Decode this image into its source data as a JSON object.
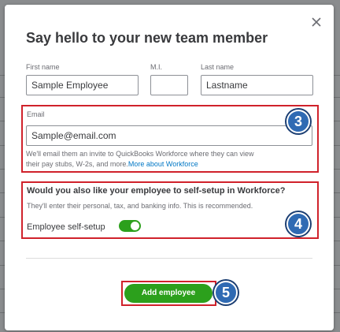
{
  "modal": {
    "title": "Say hello to your new team member"
  },
  "name_fields": {
    "first_name_label": "First name",
    "first_name_value": "Sample Employee",
    "mi_label": "M.I.",
    "mi_value": "",
    "last_name_label": "Last name",
    "last_name_value": "Lastname"
  },
  "email_section": {
    "label": "Email",
    "value": "Sample@email.com",
    "help_line1": "We'll email them an invite to QuickBooks Workforce where they can view",
    "help_line2": "their pay stubs, W-2s, and more.",
    "help_link": "More about Workforce",
    "step_badge": "3"
  },
  "self_setup_section": {
    "question": "Would you also like your employee to self-setup in Workforce?",
    "description": "They'll enter their personal, tax, and banking info. This is recommended.",
    "toggle_label": "Employee self-setup",
    "toggle_state": "on",
    "step_badge": "4"
  },
  "footer": {
    "add_button_label": "Add employee",
    "step_badge": "5"
  },
  "colors": {
    "accent_green": "#2ca01c",
    "annotation_red": "#d0222b",
    "badge_blue": "#2f6ab3",
    "link_blue": "#0077c5"
  },
  "icons": {
    "close": "close-icon"
  }
}
